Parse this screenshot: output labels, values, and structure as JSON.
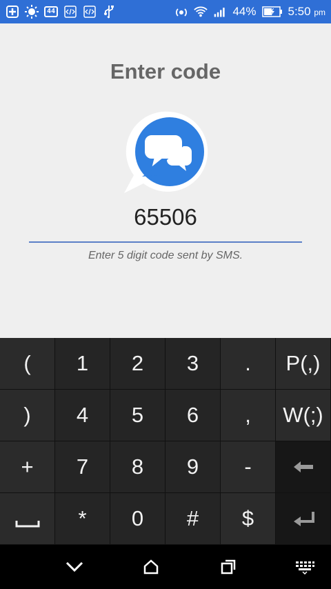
{
  "status_bar": {
    "notif_badge": "44",
    "battery_percent": "44%",
    "time": "5:50",
    "time_suffix": "pm"
  },
  "screen": {
    "title": "Enter code",
    "code_value": "65506",
    "hint": "Enter 5 digit code sent by SMS."
  },
  "keypad": {
    "rows": [
      [
        "(",
        "1",
        "2",
        "3",
        ".",
        "P(,)"
      ],
      [
        ")",
        "4",
        "5",
        "6",
        ",",
        "W(;)"
      ],
      [
        "+",
        "7",
        "8",
        "9",
        "-",
        ""
      ],
      [
        "",
        "*",
        "0",
        "#",
        "$",
        ""
      ]
    ]
  },
  "colors": {
    "status_bar": "#2f6fd6",
    "logo_blue": "#2f7fe0",
    "underline": "#5b7fc7"
  }
}
